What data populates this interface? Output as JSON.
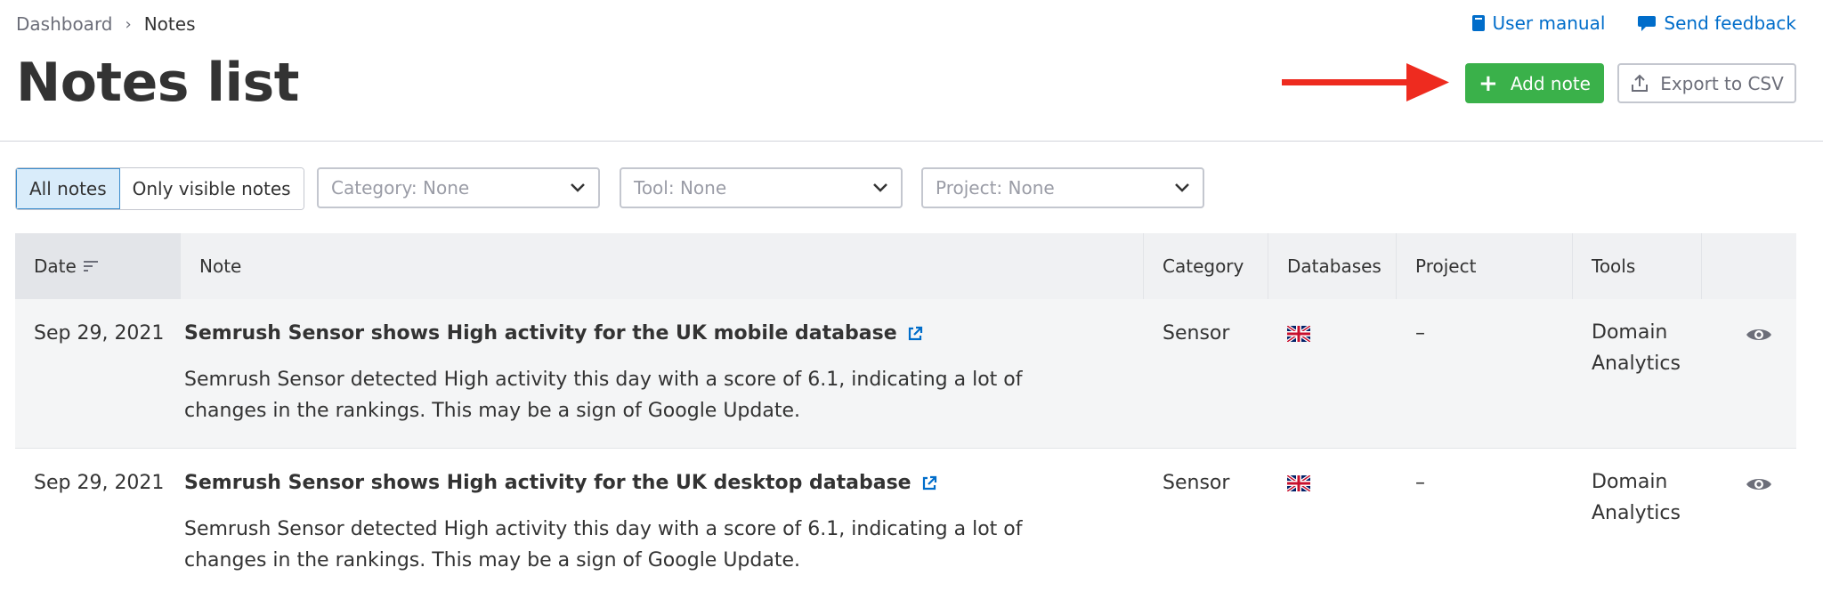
{
  "breadcrumb": {
    "items": [
      "Dashboard",
      "Notes"
    ],
    "separator": "›"
  },
  "top_links": {
    "user_manual": "User manual",
    "send_feedback": "Send feedback"
  },
  "page_title": "Notes list",
  "actions": {
    "add_note": "Add note",
    "export_csv": "Export to CSV"
  },
  "filters": {
    "visibility": {
      "options": [
        "All notes",
        "Only visible notes"
      ],
      "selected": "All notes"
    },
    "category": "Category: None",
    "tool": "Tool: None",
    "project": "Project: None"
  },
  "table": {
    "columns": [
      "Date",
      "Note",
      "Category",
      "Databases",
      "Project",
      "Tools"
    ],
    "rows": [
      {
        "date": "Sep 29, 2021",
        "title": "Semrush Sensor shows High activity for the UK mobile database",
        "desc_line1": "Semrush Sensor detected High activity this day with a score of 6.1, indicating a lot of",
        "desc_line2": "changes in the rankings. This may be a sign of Google Update.",
        "category": "Sensor",
        "database": "uk-flag-icon",
        "project": "–",
        "tools_line1": "Domain",
        "tools_line2": "Analytics"
      },
      {
        "date": "Sep 29, 2021",
        "title": "Semrush Sensor shows High activity for the UK desktop database",
        "desc_line1": "Semrush Sensor detected High activity this day with a score of 6.1, indicating a lot of",
        "desc_line2": "changes in the rankings. This may be a sign of Google Update.",
        "category": "Sensor",
        "database": "uk-flag-icon",
        "project": "–",
        "tools_line1": "Domain",
        "tools_line2": "Analytics"
      }
    ]
  },
  "colors": {
    "accent_green": "#3ab14a",
    "link_blue": "#006dca",
    "arrow_red": "#ee2b1f"
  }
}
